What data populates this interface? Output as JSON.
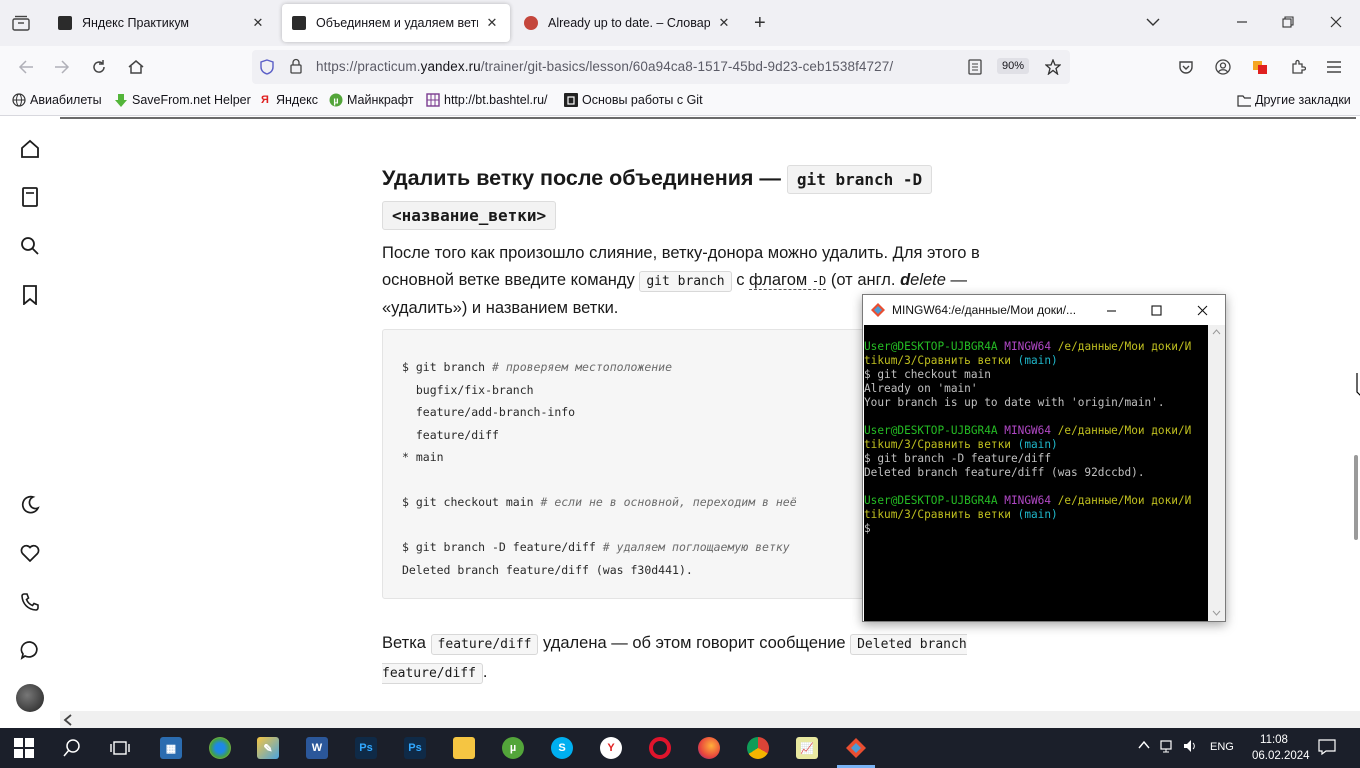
{
  "browser": {
    "tabs": [
      {
        "title": "Яндекс Практикум",
        "active": false
      },
      {
        "title": "Объединяем и удаляем ветки – ",
        "active": true
      },
      {
        "title": "Already up to date. – Словарь и",
        "active": false
      }
    ],
    "url_prefix": "https://practicum.",
    "url_domain": "yandex.ru",
    "url_path": "/trainer/git-basics/lesson/60a94ca8-1517-45bd-9d23-ceb1538f4727/",
    "zoom": "90%",
    "bookmarks": [
      "Авиабилеты",
      "SaveFrom.net Helper",
      "Яндекс",
      "Майнкрафт",
      "http://bt.bashtel.ru/",
      "Основы работы с Git"
    ],
    "other_bookmarks": "Другие закладки"
  },
  "article": {
    "heading_text": "Удалить ветку после объединения — ",
    "heading_code_1": "git branch -D",
    "heading_code_2": "<название_ветки>",
    "para1_a": "После того как произошло слияние, ветку-донора можно удалить. Для этого в основной ветке введите команду ",
    "para1_code": "git branch",
    "para1_b": " с ",
    "para1_link": "флагом",
    "para1_flag": "-D",
    "para1_c": " (от англ. ",
    "para1_em_d": "d",
    "para1_em_rest": "elete",
    "para1_d": " — «удалить») и названием ветки.",
    "code_lines": [
      {
        "code": "$ git branch ",
        "comment": "# проверяем местоположение"
      },
      {
        "code": "  bugfix/fix-branch",
        "comment": ""
      },
      {
        "code": "  feature/add-branch-info",
        "comment": ""
      },
      {
        "code": "  feature/diff",
        "comment": ""
      },
      {
        "code": "* main",
        "comment": ""
      },
      {
        "code": "",
        "comment": ""
      },
      {
        "code": "$ git checkout main ",
        "comment": "# если не в основной, переходим в неё"
      },
      {
        "code": "",
        "comment": ""
      },
      {
        "code": "$ git branch -D feature/diff ",
        "comment": "# удаляем поглощаемую ветку"
      },
      {
        "code": "Deleted branch feature/diff (was f30d441).",
        "comment": ""
      }
    ],
    "para2_a": "Ветка ",
    "para2_code1": "feature/diff",
    "para2_b": " удалена — об этом говорит сообщение ",
    "para2_code2": "Deleted branch feature/diff",
    "para2_c": "."
  },
  "terminal": {
    "title": "MINGW64:/e/данные/Мои доки/...",
    "user": "User@DESKTOP-UJBGR4A",
    "env": "MINGW64",
    "path1": "/e/данные/Мои доки/И",
    "path2": "tikum/3/Сравнить ветки",
    "branch": "(main)",
    "cmd1": "$ git checkout main",
    "out1a": "Already on 'main'",
    "out1b": "Your branch is up to date with 'origin/main'.",
    "cmd2": "$ git branch -D feature/diff",
    "out2": "Deleted branch feature/diff (was 92dccbd).",
    "prompt": "$"
  },
  "taskbar": {
    "lang": "ENG",
    "time": "11:08",
    "date": "06.02.2024"
  }
}
